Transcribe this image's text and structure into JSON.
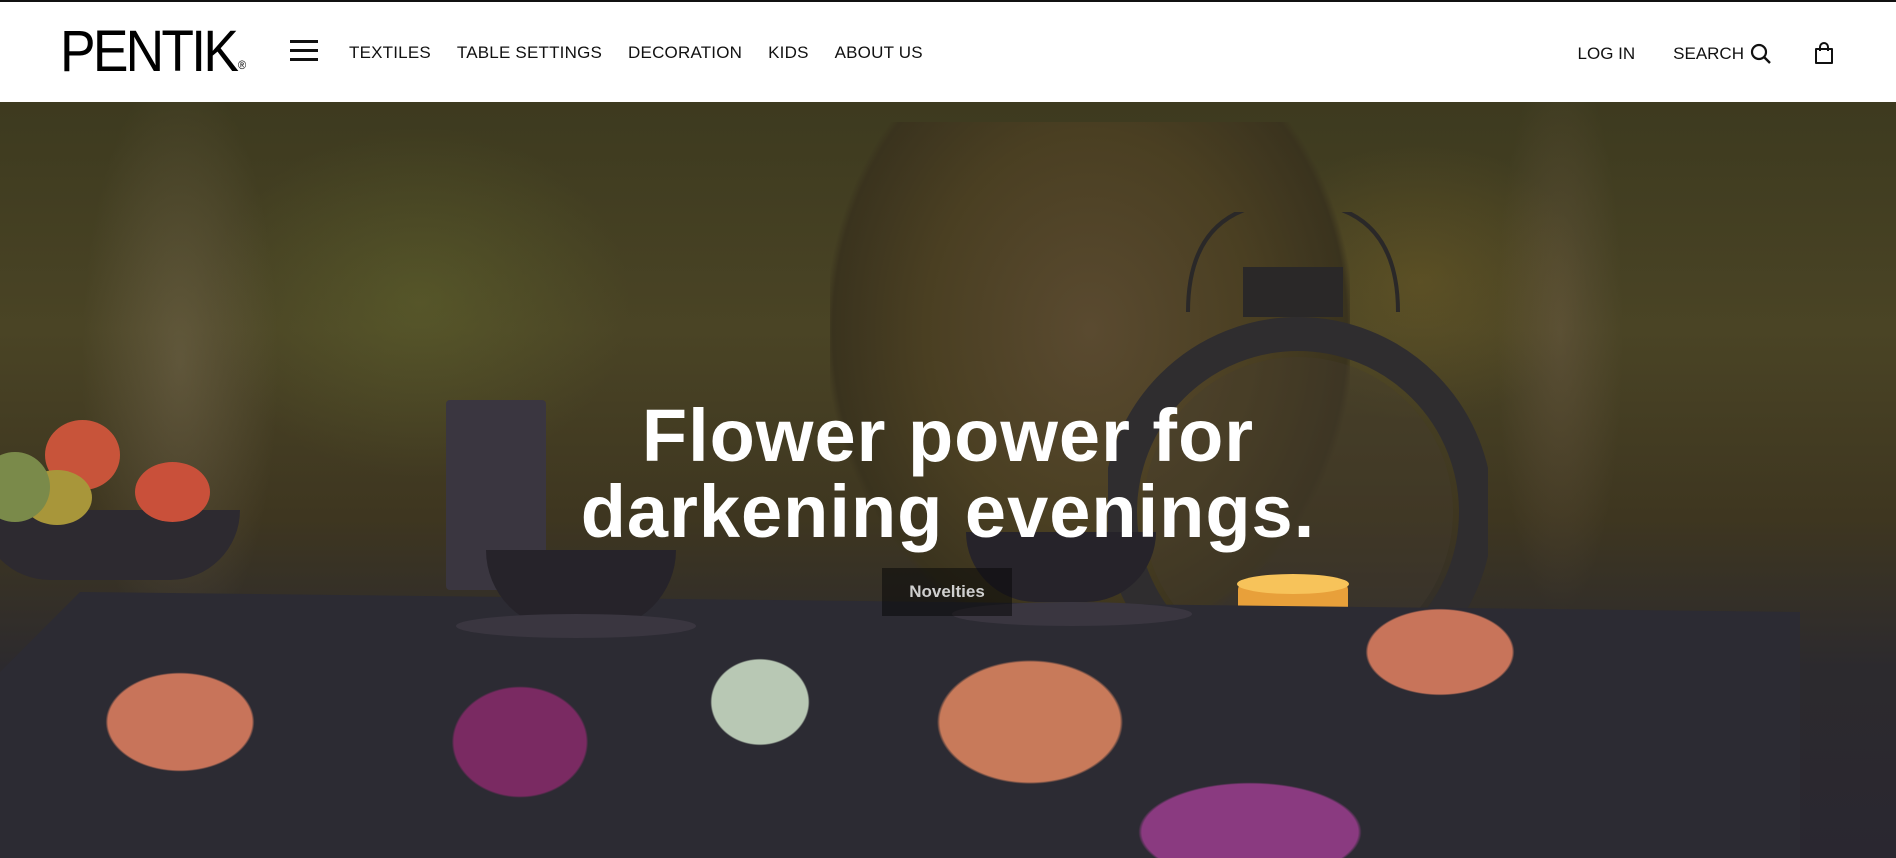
{
  "brand": {
    "logo_text": "PENTIK",
    "logo_mark": "®"
  },
  "header": {
    "menu_icon": "hamburger-menu-icon",
    "nav": [
      "TEXTILES",
      "TABLE SETTINGS",
      "DECORATION",
      "KIDS",
      "ABOUT US"
    ],
    "login_label": "LOG IN",
    "search_label": "SEARCH",
    "search_icon": "search-icon",
    "cart_icon": "shopping-bag-icon"
  },
  "hero": {
    "title_line1": "Flower power for",
    "title_line2": "darkening evenings.",
    "button_label": "Novelties"
  },
  "colors": {
    "header_bg": "#ffffff",
    "text": "#111111",
    "hero_text": "#ffffff",
    "button_bg": "rgba(10,10,10,0.55)"
  }
}
